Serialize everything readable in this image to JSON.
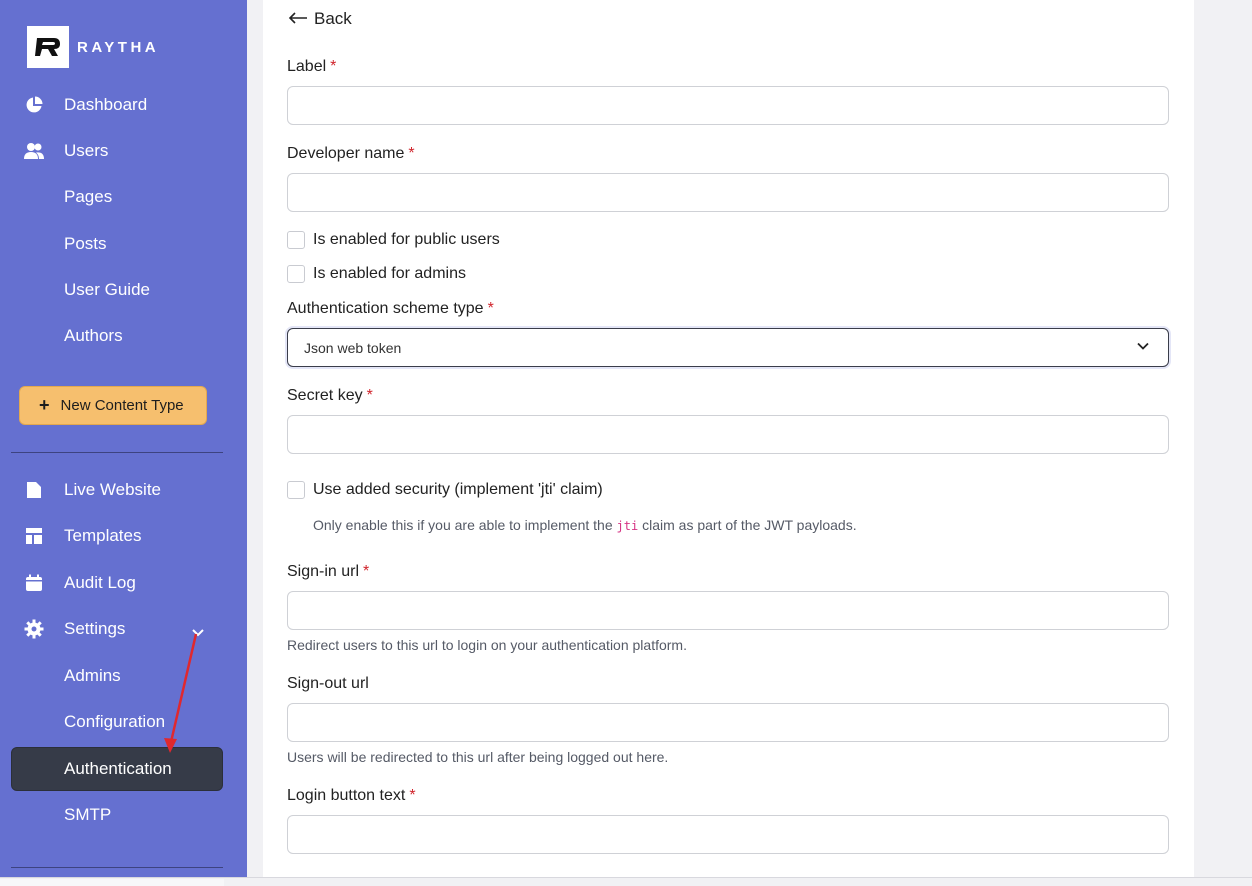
{
  "app": {
    "logo_text": "RAYTHA"
  },
  "sidebar": {
    "items": [
      {
        "label": "Dashboard",
        "icon": "pie-chart-icon"
      },
      {
        "label": "Users",
        "icon": "users-icon"
      },
      {
        "label": "Pages"
      },
      {
        "label": "Posts"
      },
      {
        "label": "User Guide"
      },
      {
        "label": "Authors"
      }
    ],
    "new_content_type": "New Content Type",
    "bottom_items": [
      {
        "label": "Live Website",
        "icon": "file-icon"
      },
      {
        "label": "Templates",
        "icon": "layout-icon"
      },
      {
        "label": "Audit Log",
        "icon": "calendar-icon"
      },
      {
        "label": "Settings",
        "icon": "gear-icon"
      },
      {
        "label": "Admins"
      },
      {
        "label": "Configuration"
      },
      {
        "label": "Authentication",
        "active": true
      },
      {
        "label": "SMTP"
      }
    ]
  },
  "form": {
    "back": "Back",
    "label_field": {
      "label": "Label",
      "value": ""
    },
    "developer_name": {
      "label": "Developer name",
      "value": ""
    },
    "enabled_public": {
      "label": "Is enabled for public users",
      "checked": false
    },
    "enabled_admins": {
      "label": "Is enabled for admins",
      "checked": false
    },
    "scheme_type": {
      "label": "Authentication scheme type",
      "value": "Json web token"
    },
    "secret_key": {
      "label": "Secret key",
      "value": ""
    },
    "jti": {
      "label": "Use added security (implement 'jti' claim)",
      "checked": false,
      "help_before": "Only enable this if you are able to implement the",
      "help_code": "jti",
      "help_after": "claim as part of the JWT payloads."
    },
    "signin_url": {
      "label": "Sign-in url",
      "value": "",
      "help": "Redirect users to this url to login on your authentication platform."
    },
    "signout_url": {
      "label": "Sign-out url",
      "value": "",
      "help": "Users will be redirected to this url after being logged out here."
    },
    "login_button_text": {
      "label": "Login button text",
      "value": ""
    },
    "required_mark": "*"
  },
  "colors": {
    "sidebar_bg": "#6570d0",
    "active_item_bg": "#363b48",
    "accent_button": "#f6bf6e",
    "required": "#d0232b",
    "annotation_arrow": "#e0282e"
  }
}
